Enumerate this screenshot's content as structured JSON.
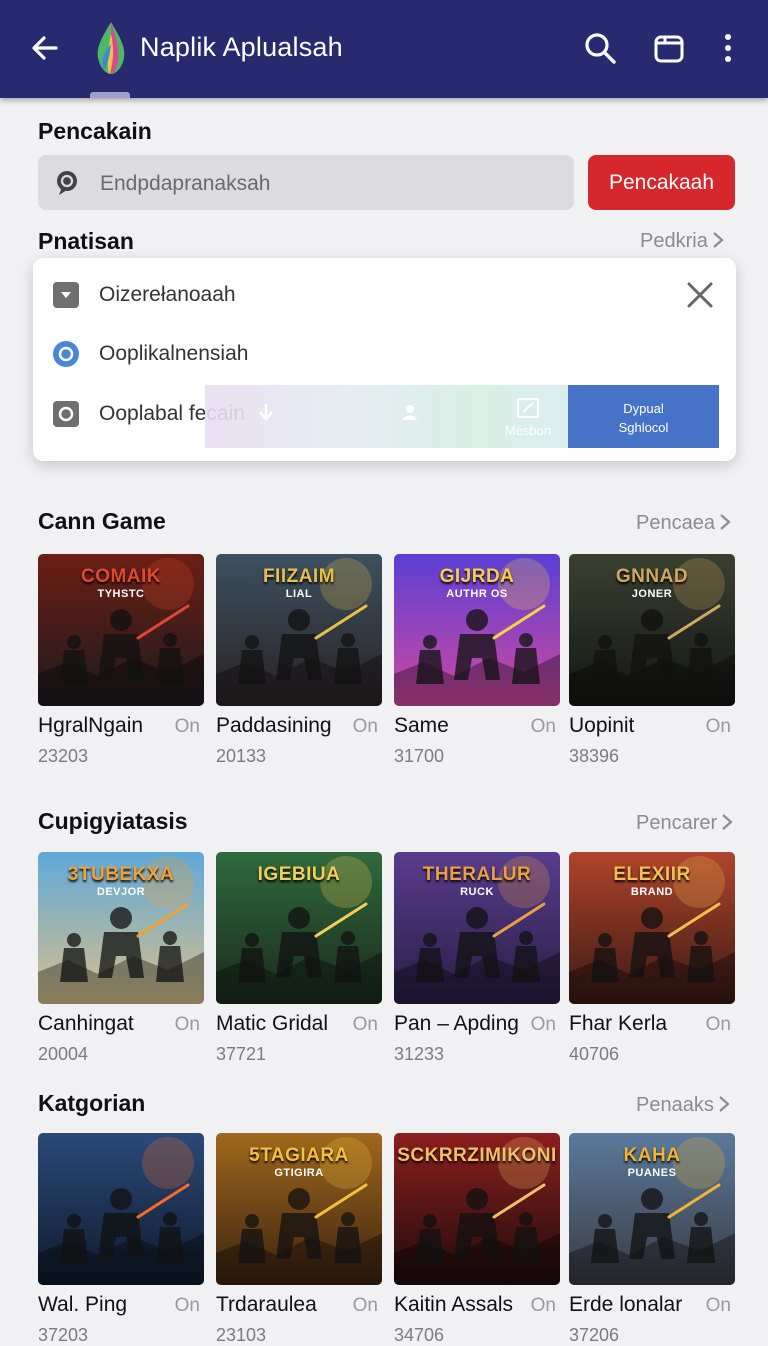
{
  "appbar": {
    "title": "Naplik Aplualsah"
  },
  "search": {
    "heading": "Pencakain",
    "placeholder": "Endpdapranaksah",
    "button": "Pencakaah"
  },
  "filter": {
    "heading": "Pnatisan",
    "more": "Pedkria",
    "options": [
      {
        "label": "Oizerełanoaah",
        "icon": "dropdown-square-icon"
      },
      {
        "label": "Ooplikalnensiah",
        "icon": "radio-icon"
      },
      {
        "label": "Ooplabal fecain",
        "icon": "radio-square-icon"
      }
    ],
    "strip": {
      "mid_label": "Mesbon",
      "blue_line1": "Dypual",
      "blue_line2": "Sghlocol"
    }
  },
  "sections": [
    {
      "title": "Cann Game",
      "more": "Pencaea",
      "items": [
        {
          "title": "HgralNgain",
          "on": "On",
          "count": "23203",
          "art": "COMAIK",
          "art2": "TYHSTC",
          "bg1": "#6b1f14",
          "bg2": "#1d1a1e",
          "fg": "#e0492e"
        },
        {
          "title": "Paddasining",
          "on": "On",
          "count": "20133",
          "art": "FIIZAIM",
          "art2": "LIAL",
          "bg1": "#3c5060",
          "bg2": "#2a2224",
          "fg": "#e8c048"
        },
        {
          "title": "Same",
          "on": "On",
          "count": "31700",
          "art": "GIJRDA",
          "art2": "AUTHR OS",
          "bg1": "#5a3fd4",
          "bg2": "#d04aa0",
          "fg": "#f7d045"
        },
        {
          "title": "Uopinit",
          "on": "On",
          "count": "38396",
          "art": "GNNAD",
          "art2": "JONER",
          "bg1": "#3a4030",
          "bg2": "#151514",
          "fg": "#d2a860"
        }
      ]
    },
    {
      "title": "Cupigyiatasis",
      "more": "Pencarer",
      "items": [
        {
          "title": "Canhingat",
          "on": "On",
          "count": "20004",
          "art": "3TUBEKXA",
          "art2": "DEVJOR",
          "bg1": "#5fa8d8",
          "bg2": "#d8c08a",
          "fg": "#f3a035"
        },
        {
          "title": "Matic Gridal",
          "on": "On",
          "count": "37721",
          "art": "IGEBIUA",
          "art2": "",
          "bg1": "#2f6a3c",
          "bg2": "#1a2a1c",
          "fg": "#f2d058"
        },
        {
          "title": "Pan – Apding",
          "on": "On",
          "count": "31233",
          "art": "THERALUR",
          "art2": "RUCK",
          "bg1": "#5a3c8e",
          "bg2": "#281e44",
          "fg": "#e8a040"
        },
        {
          "title": "Fhar Kerla",
          "on": "On",
          "count": "40706",
          "art": "ELEXIIR",
          "art2": "BRAND",
          "bg1": "#b0442c",
          "bg2": "#3a1a14",
          "fg": "#f1c050"
        }
      ]
    },
    {
      "title": "Katgorian",
      "more": "Penaaks",
      "items": [
        {
          "title": "Wal. Ping",
          "on": "On",
          "count": "37203",
          "art": "",
          "art2": "",
          "bg1": "#2a4a78",
          "bg2": "#0f1a2c",
          "fg": "#ff6a28"
        },
        {
          "title": "Trdaraulea",
          "on": "On",
          "count": "23103",
          "art": "5TAGIARA",
          "art2": "GTIGIRA",
          "bg1": "#a0681c",
          "bg2": "#3c2210",
          "fg": "#f4c040"
        },
        {
          "title": "Kaitin Assals",
          "on": "On",
          "count": "34706",
          "art": "SCKRRZIMIKONI",
          "art2": "",
          "bg1": "#8c1e1e",
          "bg2": "#1e0c0c",
          "fg": "#f0c068"
        },
        {
          "title": "Erde lonalar",
          "on": "On",
          "count": "37206",
          "art": "KAHA",
          "art2": "PUANES",
          "bg1": "#5a7a9c",
          "bg2": "#3a3a44",
          "fg": "#f4b430"
        }
      ]
    }
  ]
}
